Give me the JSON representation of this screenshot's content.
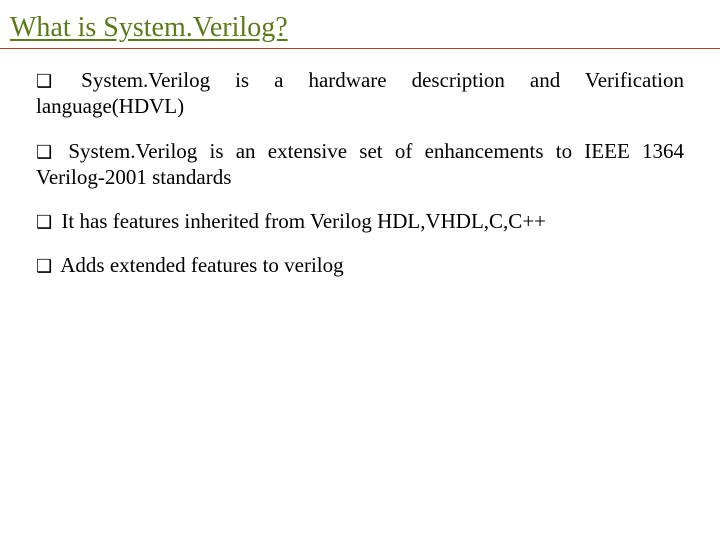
{
  "title": "What is System.Verilog?",
  "bullet_glyph": "❑",
  "items": [
    "System.Verilog is a hardware description and Verification language(HDVL)",
    "System.Verilog is an extensive set of enhancements to IEEE 1364 Verilog-2001 standards",
    "It has features inherited from Verilog HDL,VHDL,C,C++",
    "Adds extended features to verilog"
  ]
}
